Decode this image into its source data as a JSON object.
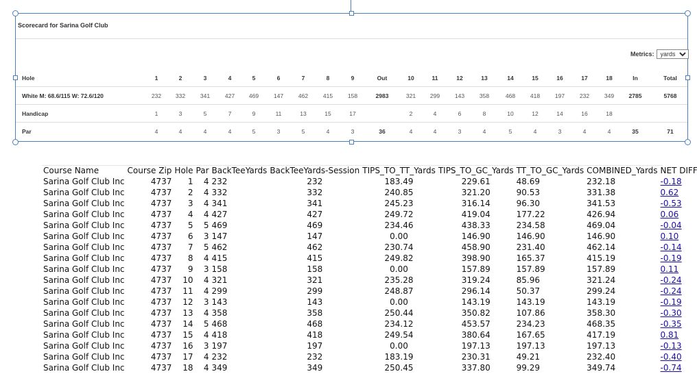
{
  "scorecard": {
    "title": "Scorecard for Sarina Golf Club",
    "metrics_label": "Metrics:",
    "metrics_value": "yards",
    "rows": [
      {
        "label": "Hole",
        "header": true,
        "cells": [
          "1",
          "2",
          "3",
          "4",
          "5",
          "6",
          "7",
          "8",
          "9",
          "Out",
          "10",
          "11",
          "12",
          "13",
          "14",
          "15",
          "16",
          "17",
          "18",
          "In",
          "Total"
        ]
      },
      {
        "label": "White M: 68.6/115 W: 72.6/120",
        "cells": [
          "232",
          "332",
          "341",
          "427",
          "469",
          "147",
          "462",
          "415",
          "158",
          "2983",
          "321",
          "299",
          "143",
          "358",
          "468",
          "418",
          "197",
          "232",
          "349",
          "2785",
          "5768"
        ]
      },
      {
        "label": "Handicap",
        "cells": [
          "1",
          "3",
          "5",
          "7",
          "9",
          "11",
          "13",
          "15",
          "17",
          "",
          "2",
          "4",
          "6",
          "8",
          "10",
          "12",
          "14",
          "16",
          "18",
          "",
          ""
        ]
      },
      {
        "label": "Par",
        "cells": [
          "4",
          "4",
          "4",
          "4",
          "5",
          "3",
          "5",
          "4",
          "3",
          "36",
          "4",
          "4",
          "3",
          "4",
          "5",
          "4",
          "3",
          "4",
          "4",
          "35",
          "71"
        ]
      }
    ]
  },
  "table": {
    "columns": [
      "Course Name",
      "Course Zip",
      "Hole",
      "Par",
      "BackTeeYards",
      "BackTeeYards-Session",
      "TIPS_TO_TT_Yards",
      "TIPS_TO_GC_Yards",
      "TT_TO_GC_Yards",
      "COMBINED_Yards",
      "NET DIFF"
    ],
    "rows": [
      [
        "Sarina Golf Club Inc",
        "4737",
        "1",
        "4",
        "232",
        "232",
        "183.49",
        "229.61",
        "48.69",
        "232.18",
        "-0.18"
      ],
      [
        "Sarina Golf Club Inc",
        "4737",
        "2",
        "4",
        "332",
        "332",
        "240.85",
        "321.20",
        "90.53",
        "331.38",
        "0.62"
      ],
      [
        "Sarina Golf Club Inc",
        "4737",
        "3",
        "4",
        "341",
        "341",
        "245.23",
        "316.14",
        "96.30",
        "341.53",
        "-0.53"
      ],
      [
        "Sarina Golf Club Inc",
        "4737",
        "4",
        "4",
        "427",
        "427",
        "249.72",
        "419.04",
        "177.22",
        "426.94",
        "0.06"
      ],
      [
        "Sarina Golf Club Inc",
        "4737",
        "5",
        "5",
        "469",
        "469",
        "234.46",
        "438.33",
        "234.58",
        "469.04",
        "-0.04"
      ],
      [
        "Sarina Golf Club Inc",
        "4737",
        "6",
        "3",
        "147",
        "147",
        "0.00",
        "146.90",
        "146.90",
        "146.90",
        "0.10"
      ],
      [
        "Sarina Golf Club Inc",
        "4737",
        "7",
        "5",
        "462",
        "462",
        "230.74",
        "458.90",
        "231.40",
        "462.14",
        "-0.14"
      ],
      [
        "Sarina Golf Club Inc",
        "4737",
        "8",
        "4",
        "415",
        "415",
        "249.82",
        "398.90",
        "165.37",
        "415.19",
        "-0.19"
      ],
      [
        "Sarina Golf Club Inc",
        "4737",
        "9",
        "3",
        "158",
        "158",
        "0.00",
        "157.89",
        "157.89",
        "157.89",
        "0.11"
      ],
      [
        "Sarina Golf Club Inc",
        "4737",
        "10",
        "4",
        "321",
        "321",
        "235.28",
        "319.24",
        "85.96",
        "321.24",
        "-0.24"
      ],
      [
        "Sarina Golf Club Inc",
        "4737",
        "11",
        "4",
        "299",
        "299",
        "248.87",
        "296.14",
        "50.37",
        "299.24",
        "-0.24"
      ],
      [
        "Sarina Golf Club Inc",
        "4737",
        "12",
        "3",
        "143",
        "143",
        "0.00",
        "143.19",
        "143.19",
        "143.19",
        "-0.19"
      ],
      [
        "Sarina Golf Club Inc",
        "4737",
        "13",
        "4",
        "358",
        "358",
        "250.44",
        "350.82",
        "107.86",
        "358.30",
        "-0.30"
      ],
      [
        "Sarina Golf Club Inc",
        "4737",
        "14",
        "5",
        "468",
        "468",
        "234.12",
        "453.57",
        "234.23",
        "468.35",
        "-0.35"
      ],
      [
        "Sarina Golf Club Inc",
        "4737",
        "15",
        "4",
        "418",
        "418",
        "249.54",
        "380.64",
        "167.65",
        "417.19",
        "0.81"
      ],
      [
        "Sarina Golf Club Inc",
        "4737",
        "16",
        "3",
        "197",
        "197",
        "0.00",
        "197.13",
        "197.13",
        "197.13",
        "-0.13"
      ],
      [
        "Sarina Golf Club Inc",
        "4737",
        "17",
        "4",
        "232",
        "232",
        "183.19",
        "230.31",
        "49.21",
        "232.40",
        "-0.40"
      ],
      [
        "Sarina Golf Club Inc",
        "4737",
        "18",
        "4",
        "349",
        "349",
        "250.45",
        "337.80",
        "99.29",
        "349.74",
        "-0.74"
      ]
    ]
  }
}
